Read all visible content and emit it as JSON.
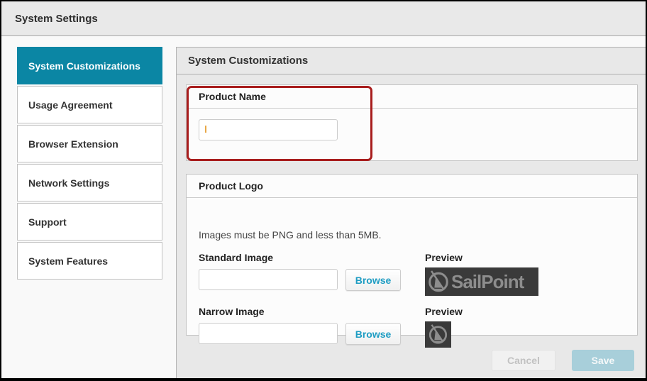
{
  "header": {
    "title": "System Settings"
  },
  "sidebar": {
    "items": [
      {
        "label": "System Customizations",
        "selected": true
      },
      {
        "label": "Usage Agreement",
        "selected": false
      },
      {
        "label": "Browser Extension",
        "selected": false
      },
      {
        "label": "Network Settings",
        "selected": false
      },
      {
        "label": "Support",
        "selected": false
      },
      {
        "label": "System Features",
        "selected": false
      }
    ]
  },
  "main": {
    "title": "System Customizations",
    "product_name": {
      "title": "Product Name",
      "value": ""
    },
    "product_logo": {
      "title": "Product Logo",
      "note": "Images must be PNG and less than 5MB.",
      "standard_image": {
        "label": "Standard Image",
        "value": "",
        "browse_label": "Browse",
        "preview_label": "Preview",
        "logo_text": "SailPoint"
      },
      "narrow_image": {
        "label": "Narrow Image",
        "value": "",
        "browse_label": "Browse",
        "preview_label": "Preview"
      }
    },
    "footer": {
      "cancel_label": "Cancel",
      "save_label": "Save"
    }
  },
  "annotation": {
    "type": "highlight-box",
    "target": "Product Name section",
    "color": "#a81d1d"
  },
  "colors": {
    "selected_nav_teal": "#0b86a4",
    "browse_link_blue": "#1f9dc3",
    "save_disabled_teal": "#a8cfda",
    "logo_background": "#3a3a3a",
    "logo_gray": "#8d8d8d"
  }
}
